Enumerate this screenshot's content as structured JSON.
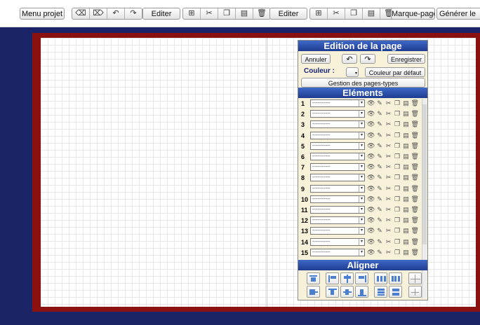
{
  "toolbar": {
    "menu_projet": "Menu projet",
    "editer_1": "Editer",
    "editer_2": "Editer",
    "marque_page": "Marque-page",
    "generer": "Générer le"
  },
  "panel": {
    "edition_title": "Edition de la page",
    "annuler": "Annuler",
    "enregistrer": "Enregistrer",
    "couleur_label": "Couleur :",
    "couleur_defaut": "Couleur par défaut",
    "gestion": "Gestion des pages-types",
    "elements_title": "Eléments",
    "aligner_title": "Aligner",
    "element_rows": [
      {
        "num": "1",
        "value": "-----------"
      },
      {
        "num": "2",
        "value": "-----------"
      },
      {
        "num": "3",
        "value": "-----------"
      },
      {
        "num": "4",
        "value": "-----------"
      },
      {
        "num": "5",
        "value": "-----------"
      },
      {
        "num": "6",
        "value": "-----------"
      },
      {
        "num": "7",
        "value": "-----------"
      },
      {
        "num": "8",
        "value": "-----------"
      },
      {
        "num": "9",
        "value": "-----------"
      },
      {
        "num": "10",
        "value": "-----------"
      },
      {
        "num": "11",
        "value": "-----------"
      },
      {
        "num": "12",
        "value": "-----------"
      },
      {
        "num": "13",
        "value": "-----------"
      },
      {
        "num": "14",
        "value": "-----------"
      },
      {
        "num": "15",
        "value": "-----------"
      }
    ],
    "row_icons": [
      "eye-icon",
      "brush-icon",
      "scissors-icon",
      "copy-icon",
      "paste-icon",
      "trash-icon"
    ]
  },
  "colors": {
    "background": "#1a2466",
    "frame": "#8b1010",
    "panel": "#f6f1d8",
    "header": "#2a52b0"
  }
}
